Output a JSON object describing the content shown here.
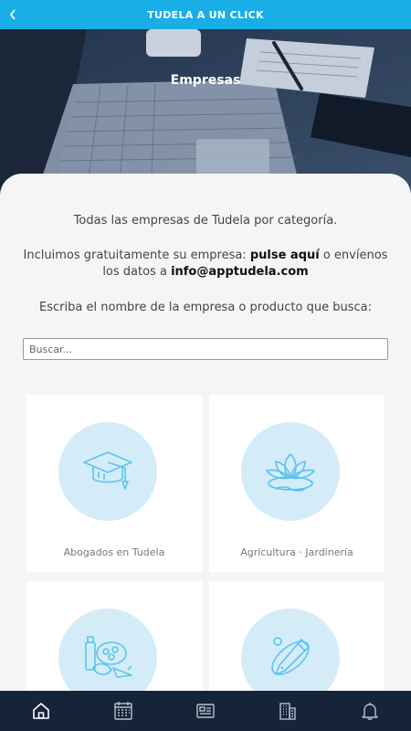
{
  "topbar": {
    "title": "TUDELA A UN CLICK",
    "back_icon": "chevron-left-icon"
  },
  "hero": {
    "title": "Empresas"
  },
  "intro": {
    "line1": "Todas las empresas de Tudela por categoría.",
    "line2_pre": "Incluimos gratuitamente su empresa: ",
    "line2_link": "pulse aquí",
    "line2_post": " o envíenos",
    "line3_pre": "los datos a ",
    "line3_email": "info@apptudela.com",
    "line4": "Escriba el nombre de la empresa o producto que busca:"
  },
  "search": {
    "placeholder": "Buscar...",
    "value": ""
  },
  "categories": [
    {
      "label": "Abogados en Tudela",
      "icon": "graduation-cap-icon"
    },
    {
      "label": "Agricultura · Jardinería",
      "icon": "lotus-icon"
    },
    {
      "label": "",
      "icon": "groceries-icon"
    },
    {
      "label": "",
      "icon": "pen-tool-icon"
    }
  ],
  "bottom_nav": [
    {
      "icon": "home-icon"
    },
    {
      "icon": "calendar-icon"
    },
    {
      "icon": "newspaper-icon"
    },
    {
      "icon": "building-icon"
    },
    {
      "icon": "bell-icon"
    }
  ],
  "colors": {
    "accent": "#19aee6",
    "nav_bg": "#16243a",
    "icon_circle": "#d4ecf8",
    "icon_stroke": "#5cc3ec"
  }
}
